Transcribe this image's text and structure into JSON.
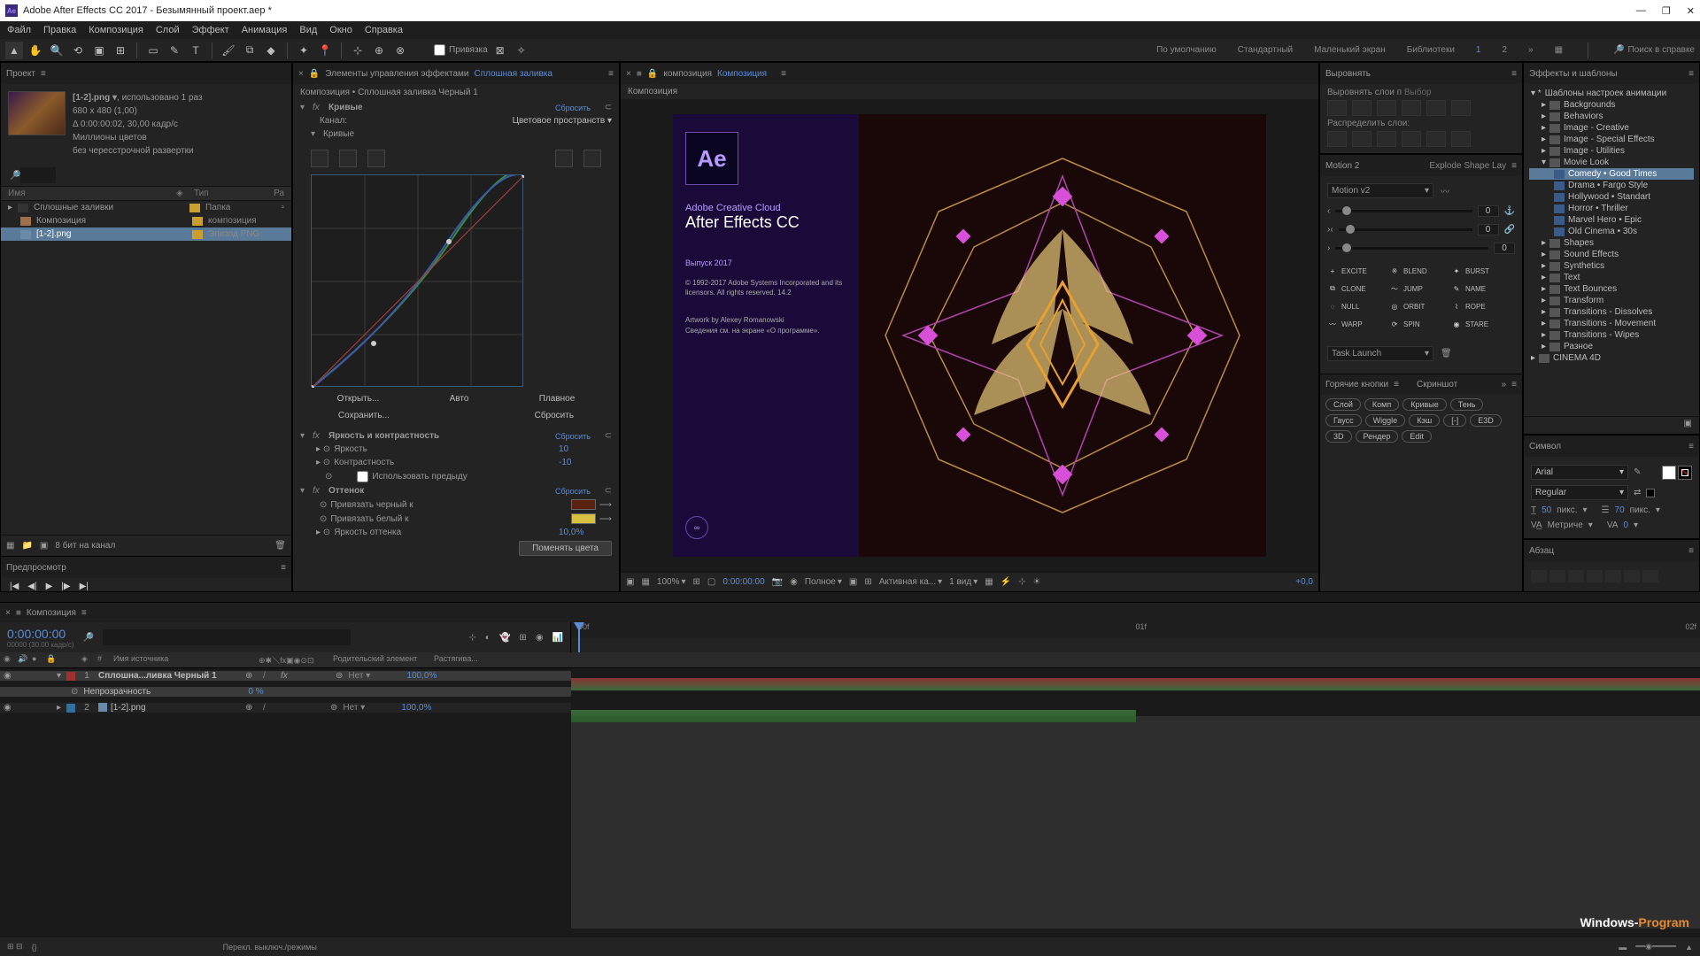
{
  "window": {
    "title": "Adobe After Effects CC 2017 - Безымянный проект.aep *"
  },
  "menubar": [
    "Файл",
    "Правка",
    "Композиция",
    "Слой",
    "Эффект",
    "Анимация",
    "Вид",
    "Окно",
    "Справка"
  ],
  "toolbar": {
    "snap_label": "Привязка",
    "workspaces": [
      "По умолчанию",
      "Стандартный",
      "Маленький экран",
      "Библиотеки"
    ],
    "ws_numbers": [
      "1",
      "2"
    ],
    "search_placeholder": "Поиск в справке"
  },
  "project": {
    "tab": "Проект",
    "item_name": "[1-2].png ▾",
    "item_used": ", использовано 1 раз",
    "dims": "680 x 480 (1,00)",
    "duration": "Δ 0:00:00:02, 30,00 кадр/с",
    "colors": "Миллионы цветов",
    "interlace": "без чересстрочной развертки",
    "head_name": "Имя",
    "head_type": "Тип",
    "head_ra": "Ра",
    "items": [
      {
        "name": "Сплошные заливки",
        "type": "Папка",
        "folder": true
      },
      {
        "name": "Композиция",
        "type": "композиция",
        "comp": true
      },
      {
        "name": "[1-2].png",
        "type": "Эпизод PNG",
        "sel": true
      }
    ],
    "footer_bpc": "8 бит на канал"
  },
  "preview": {
    "tab": "Предпросмотр"
  },
  "effect_controls": {
    "tab_prefix": "Элементы управления эффектами",
    "tab_layer": "Сплошная заливка",
    "comp_path": "Композиция • Сплошная заливка Черный 1",
    "fx_curves": "Кривые",
    "reset": "Сбросить",
    "channel_label": "Канал:",
    "channel_value": "Цветовое пространств",
    "curves_sub": "Кривые",
    "open": "Открыть...",
    "auto": "Авто",
    "smooth": "Плавное",
    "save": "Сохранить...",
    "reset2": "Сбросить",
    "fx_bc": "Яркость и контрастность",
    "brightness": "Яркость",
    "brightness_val": "10",
    "contrast": "Контрастность",
    "contrast_val": "-10",
    "use_legacy": "Использовать предыду",
    "fx_tint": "Оттенок",
    "map_black": "Привязать черный к",
    "map_white": "Привязать белый к",
    "tint_amount": "Яркость оттенка",
    "tint_val": "10,0%",
    "swap_btn": "Поменять цвета"
  },
  "comp_panel": {
    "tab_prefix": "композиция",
    "tab_name": "Композиция",
    "path": "Композиция",
    "zoom": "100%",
    "timecode": "0:00:00:00",
    "full": "Полное",
    "active_cam": "Активная ка...",
    "views": "1 вид",
    "exposure": "+0,0"
  },
  "splash": {
    "cloud": "Adobe Creative Cloud",
    "product": "After Effects CC",
    "release": "Выпуск 2017",
    "legal1": "© 1992-2017 Adobe Systems Incorporated and its licensors. All rights reserved. 14.2",
    "legal2": "Artwork by Alexey Romanowski",
    "legal3": "Сведения см. на экране «О программе»."
  },
  "align": {
    "tab": "Выровнять",
    "align_to": "Выровнять слои п",
    "align_to_val": "Выбор",
    "distribute": "Распределить слои:"
  },
  "motion": {
    "tab": "Motion 2",
    "preset": "Explode Shape Lay",
    "preset2": "Motion v2",
    "val0": "0",
    "buttons": [
      "EXCITE",
      "BLEND",
      "BURST",
      "CLONE",
      "JUMP",
      "NAME",
      "NULL",
      "ORBIT",
      "ROPE",
      "WARP",
      "SPIN",
      "STARE"
    ],
    "task": "Task Launch",
    "hotkeys_tab": "Горячие кнопки",
    "screenshot_tab": "Скриншот",
    "pills": [
      "Слой",
      "Комп",
      "Кривые",
      "Тень",
      "Гаусс",
      "Wiggle",
      "Кэш",
      "[-]",
      "E3D",
      "3D",
      "Рендер",
      "Edit"
    ]
  },
  "effects_browser": {
    "tab": "Эффекты и шаблоны",
    "root": "Шаблоны настроек анимации",
    "folders": [
      "Backgrounds",
      "Behaviors",
      "Image - Creative",
      "Image - Special Effects",
      "Image - Utilities"
    ],
    "movie_look": "Movie Look",
    "movie_items": [
      "Comedy • Good Times",
      "Drama • Fargo Style",
      "Hollywood • Standart",
      "Horror • Thriller",
      "Marvel Hero • Epic",
      "Old Cinema • 30s"
    ],
    "after_folders": [
      "Shapes",
      "Sound Effects",
      "Synthetics",
      "Text",
      "Text Bounces",
      "Transform",
      "Transitions - Dissolves",
      "Transitions - Movement",
      "Transitions - Wipes",
      "Разное",
      "CINEMA 4D"
    ]
  },
  "character": {
    "tab": "Символ",
    "font": "Arial",
    "style": "Regular",
    "size": "50",
    "leading": "70",
    "units": "пикс.",
    "metrics": "Метриче",
    "va": "0"
  },
  "paragraph": {
    "tab": "Абзац"
  },
  "timeline": {
    "tab": "Композиция",
    "timecode": "0:00:00:00",
    "frame_info": "00000 (30.00 кадр/с)",
    "col_num": "#",
    "col_src": "Имя источника",
    "col_parent": "Родительский элемент",
    "col_stretch": "Растягива...",
    "ruler_00f": "00f",
    "ruler_01f": "01f",
    "ruler_02f": "02f",
    "layer1_name": "Сплошна...ливка Черный 1",
    "layer1_parent": "Нет",
    "layer1_stretch": "100,0%",
    "opacity_label": "Непрозрачность",
    "opacity_val": "0 %",
    "layer2_num": "2",
    "layer2_name": "[1-2].png",
    "layer2_parent": "Нет",
    "layer2_stretch": "100,0%",
    "footer_modes": "Перекл. выключ./режимы"
  },
  "watermark": {
    "w1": "Windows-",
    "w2": "Program"
  }
}
